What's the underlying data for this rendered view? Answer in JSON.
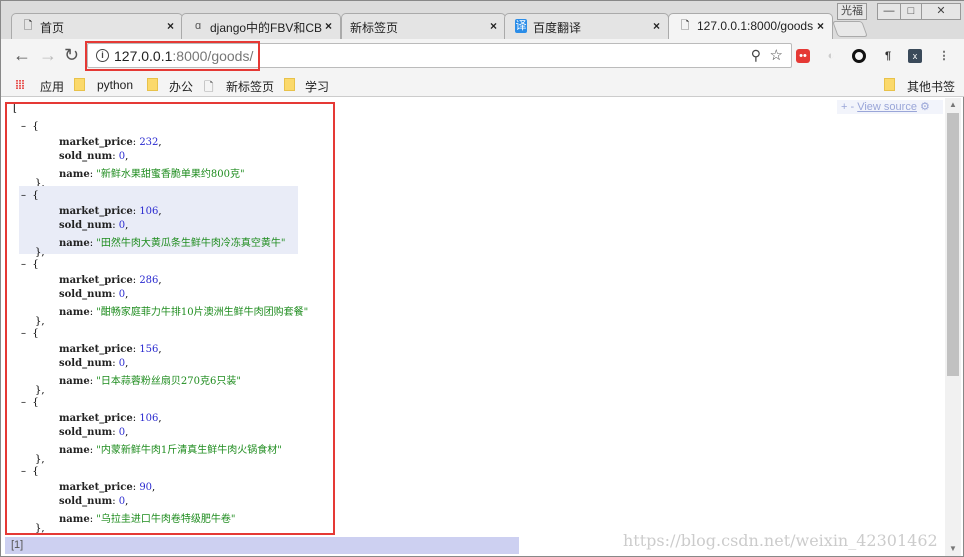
{
  "tabs": [
    {
      "title": "首页",
      "icon": "page-icon"
    },
    {
      "title": "django中的FBV和CBV",
      "icon": "django-icon"
    },
    {
      "title": "新标签页",
      "icon": ""
    },
    {
      "title": "百度翻译",
      "icon": "translate-icon"
    },
    {
      "title": "127.0.0.1:8000/goods",
      "icon": "page-icon",
      "active": true
    }
  ],
  "window": {
    "user_label": "光福",
    "minimize": "—",
    "maximize": "□",
    "close": "✕"
  },
  "address": {
    "host": "127.0.0.1",
    "path": ":8000/goods/"
  },
  "bookmarks": [
    {
      "label": "应用",
      "type": "apps"
    },
    {
      "label": "python",
      "type": "folder"
    },
    {
      "label": "办公",
      "type": "folder"
    },
    {
      "label": "新标签页",
      "type": "page"
    },
    {
      "label": "学习",
      "type": "folder"
    }
  ],
  "other_bookmarks": "其他书签",
  "viewer": {
    "plus_minus": "+ -",
    "view_source": "View source",
    "status": "[1]"
  },
  "goods": [
    {
      "market_price": "232",
      "sold_num": "0",
      "name": "\"新鲜水果甜蜜香脆单果约800克\""
    },
    {
      "market_price": "106",
      "sold_num": "0",
      "name": "\"田然牛肉大黄瓜条生鲜牛肉冷冻真空黄牛\""
    },
    {
      "market_price": "286",
      "sold_num": "0",
      "name": "\"酣畅家庭菲力牛排10片澳洲生鲜牛肉团购套餐\""
    },
    {
      "market_price": "156",
      "sold_num": "0",
      "name": "\"日本蒜蓉粉丝扇贝270克6只装\""
    },
    {
      "market_price": "106",
      "sold_num": "0",
      "name": "\"内蒙新鲜牛肉1斤清真生鲜牛肉火锅食材\""
    },
    {
      "market_price": "90",
      "sold_num": "0",
      "name": "\"乌拉圭进口牛肉卷特级肥牛卷\""
    }
  ],
  "keys": {
    "market_price": "market_price",
    "sold_num": "sold_num",
    "name": "name"
  },
  "watermark": "https://blog.csdn.net/weixin_42301462"
}
